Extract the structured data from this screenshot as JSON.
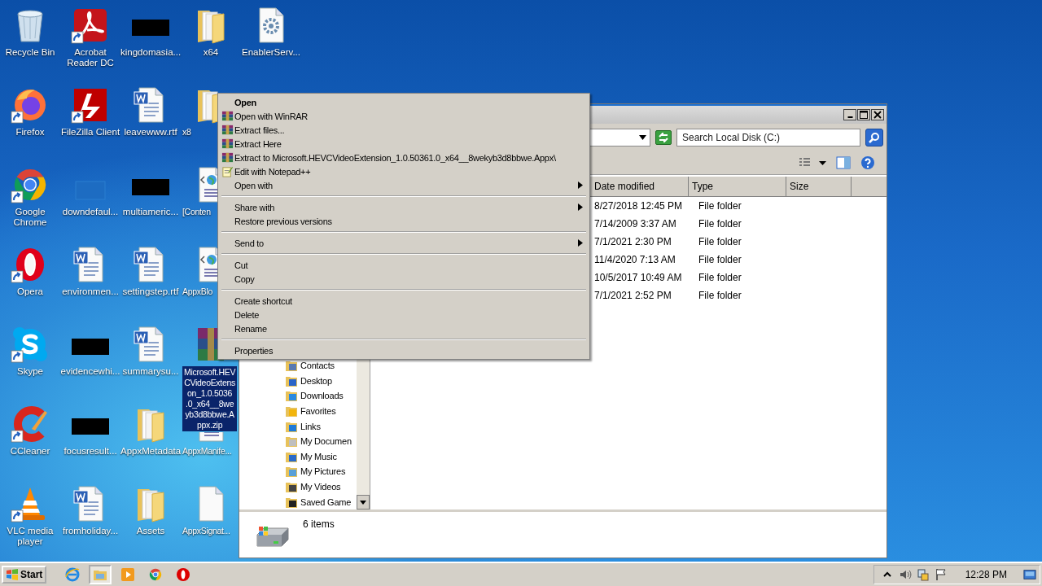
{
  "desktop_icons": [
    {
      "label": "Recycle Bin",
      "kind": "recycle",
      "shortcut": false,
      "selected": false
    },
    {
      "label": "Firefox",
      "kind": "firefox",
      "shortcut": true,
      "selected": false
    },
    {
      "label": "Google Chrome",
      "kind": "chrome",
      "shortcut": true,
      "selected": false
    },
    {
      "label": "Opera",
      "kind": "opera",
      "shortcut": true,
      "selected": false
    },
    {
      "label": "Skype",
      "kind": "skype",
      "shortcut": true,
      "selected": false
    },
    {
      "label": "CCleaner",
      "kind": "ccleaner",
      "shortcut": true,
      "selected": false
    },
    {
      "label": "VLC media player",
      "kind": "vlc",
      "shortcut": true,
      "selected": false
    },
    {
      "label": "Acrobat Reader DC",
      "kind": "pdf",
      "shortcut": true,
      "selected": false
    },
    {
      "label": "FileZilla Client",
      "kind": "filezilla",
      "shortcut": true,
      "selected": false
    },
    {
      "label": "downdefaul...",
      "kind": "blank",
      "shortcut": false,
      "selected": false
    },
    {
      "label": "environmen...",
      "kind": "word",
      "shortcut": false,
      "selected": false
    },
    {
      "label": "evidencewhi...",
      "kind": "redacted",
      "shortcut": false,
      "selected": false
    },
    {
      "label": "focusresult...",
      "kind": "redacted",
      "shortcut": false,
      "selected": false
    },
    {
      "label": "fromholiday...",
      "kind": "word",
      "shortcut": false,
      "selected": false
    },
    {
      "label": "kingdomasia...",
      "kind": "redacted",
      "shortcut": false,
      "selected": false
    },
    {
      "label": "leavewww.rtf",
      "kind": "word",
      "shortcut": false,
      "selected": false
    },
    {
      "label": "multiameric...",
      "kind": "redacted",
      "shortcut": false,
      "selected": false
    },
    {
      "label": "settingstep.rtf",
      "kind": "word",
      "shortcut": false,
      "selected": false
    },
    {
      "label": "summarysu...",
      "kind": "word",
      "shortcut": false,
      "selected": false
    },
    {
      "label": "AppxMetadata",
      "kind": "folder",
      "shortcut": false,
      "selected": false
    },
    {
      "label": "Assets",
      "kind": "folder",
      "shortcut": false,
      "selected": false
    },
    {
      "label": "x64",
      "kind": "folder",
      "shortcut": false,
      "selected": false
    },
    {
      "label": "x8",
      "kind": "folder",
      "shortcut": false,
      "selected": false
    },
    {
      "label": "[Conten",
      "kind": "html",
      "shortcut": false,
      "selected": false
    },
    {
      "label": "AppxBlo",
      "kind": "html",
      "shortcut": false,
      "selected": false
    },
    {
      "label": "Microsoft.HEV\nCVideoExtens\non_1.0.5036\n.0_x64__8we\nyb3d8bbwe.A\nppx.zip",
      "kind": "winrar",
      "shortcut": false,
      "selected": true
    },
    {
      "label": "AppxManife...",
      "kind": "html",
      "shortcut": false,
      "selected": false
    },
    {
      "label": "AppxSignat...",
      "kind": "blankdoc",
      "shortcut": false,
      "selected": false
    },
    {
      "label": "EnablerServ...",
      "kind": "gear",
      "shortcut": false,
      "selected": false
    }
  ],
  "context_menu": {
    "groups": [
      [
        {
          "label": "Open",
          "default": true,
          "submenu": false
        },
        {
          "label": "Open with WinRAR",
          "default": false,
          "submenu": false,
          "kind": "winrar"
        },
        {
          "label": "Extract files...",
          "default": false,
          "submenu": false,
          "kind": "winrar"
        },
        {
          "label": "Extract Here",
          "default": false,
          "submenu": false,
          "kind": "winrar"
        },
        {
          "label": "Extract to Microsoft.HEVCVideoExtension_1.0.50361.0_x64__8wekyb3d8bbwe.Appx\\",
          "default": false,
          "submenu": false,
          "kind": "winrar"
        },
        {
          "label": "Edit with Notepad++",
          "default": false,
          "submenu": false,
          "kind": "notepad"
        },
        {
          "label": "Open with",
          "default": false,
          "submenu": true
        }
      ],
      [
        {
          "label": "Share with",
          "default": false,
          "submenu": true
        },
        {
          "label": "Restore previous versions",
          "default": false,
          "submenu": false
        }
      ],
      [
        {
          "label": "Send to",
          "default": false,
          "submenu": true
        }
      ],
      [
        {
          "label": "Cut",
          "default": false,
          "submenu": false
        },
        {
          "label": "Copy",
          "default": false,
          "submenu": false
        }
      ],
      [
        {
          "label": "Create shortcut",
          "default": false,
          "submenu": false
        },
        {
          "label": "Delete",
          "default": false,
          "submenu": false
        },
        {
          "label": "Rename",
          "default": false,
          "submenu": false
        }
      ],
      [
        {
          "label": "Properties",
          "default": false,
          "submenu": false
        }
      ]
    ]
  },
  "explorer": {
    "search": {
      "placeholder": "Search Local Disk (C:)"
    },
    "nav_items": [
      {
        "label": "Contacts",
        "kind": "contacts"
      },
      {
        "label": "Desktop",
        "kind": "desktop"
      },
      {
        "label": "Downloads",
        "kind": "downloads"
      },
      {
        "label": "Favorites",
        "kind": "favorites"
      },
      {
        "label": "Links",
        "kind": "links"
      },
      {
        "label": "My Documen",
        "kind": "documents"
      },
      {
        "label": "My Music",
        "kind": "music"
      },
      {
        "label": "My Pictures",
        "kind": "pictures"
      },
      {
        "label": "My Videos",
        "kind": "videos"
      },
      {
        "label": "Saved Game",
        "kind": "games"
      }
    ],
    "columns": [
      "Date modified",
      "Type",
      "Size"
    ],
    "rows": [
      {
        "date_modified": "8/27/2018 12:45 PM",
        "type": "File folder"
      },
      {
        "date_modified": "7/14/2009 3:37 AM",
        "type": "File folder"
      },
      {
        "date_modified": "7/1/2021 2:30 PM",
        "type": "File folder"
      },
      {
        "date_modified": "11/4/2020 7:13 AM",
        "type": "File folder"
      },
      {
        "date_modified": "10/5/2017 10:49 AM",
        "type": "File folder"
      },
      {
        "date_modified": "7/1/2021 2:52 PM",
        "type": "File folder"
      }
    ],
    "status": "6 items"
  },
  "taskbar": {
    "start": "Start",
    "apps": [
      {
        "kind": "ie",
        "active": false
      },
      {
        "kind": "explorer",
        "active": true
      },
      {
        "kind": "media",
        "active": false
      },
      {
        "kind": "chrome",
        "active": false
      },
      {
        "kind": "opera",
        "active": false
      }
    ],
    "clock": "12:28 PM"
  }
}
